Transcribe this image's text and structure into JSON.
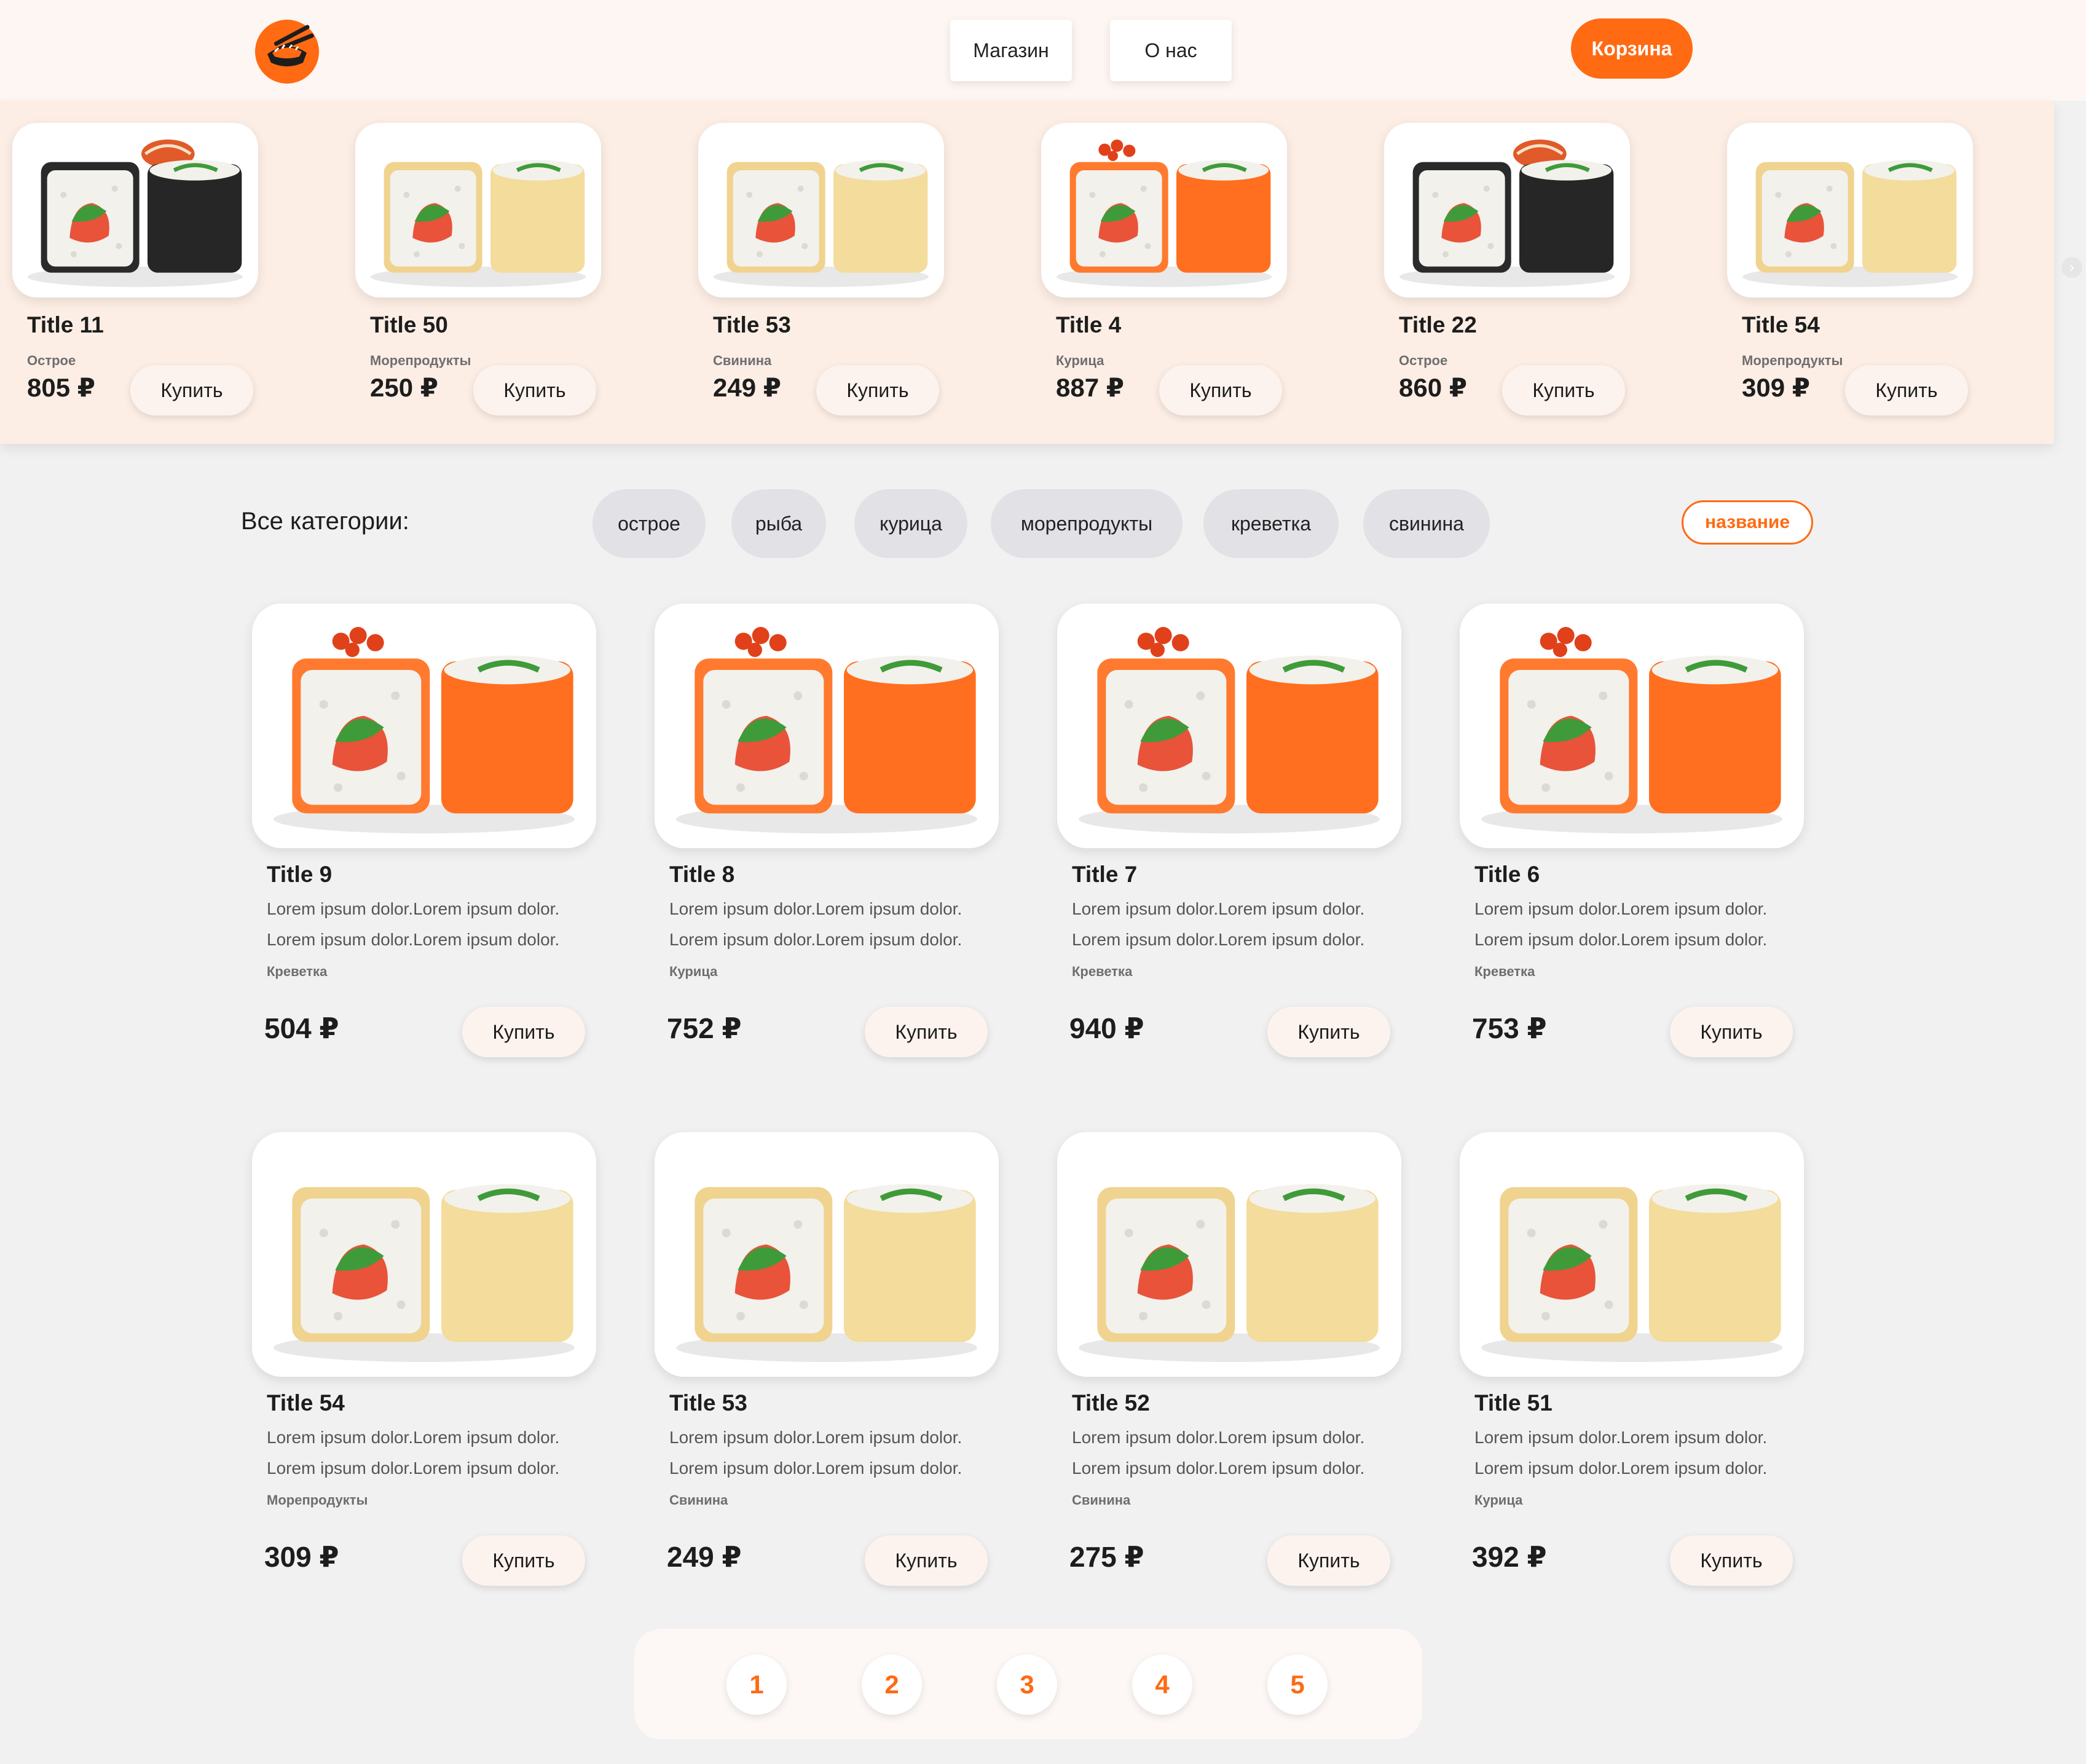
{
  "header": {
    "logo_icon": "sushi-chopsticks-icon",
    "nav": [
      "Магазин",
      "О нас"
    ],
    "cart_label": "Корзина",
    "accent": "#ff6a13"
  },
  "slider": {
    "items": [
      {
        "title": "Title 11",
        "category": "Острое",
        "price": "805 ₽",
        "buy": "Купить",
        "image": "dark-roll"
      },
      {
        "title": "Title 50",
        "category": "Морепродукты",
        "price": "250 ₽",
        "buy": "Купить",
        "image": "cheese-roll"
      },
      {
        "title": "Title 53",
        "category": "Свинина",
        "price": "249 ₽",
        "buy": "Купить",
        "image": "cheese-roll"
      },
      {
        "title": "Title 4",
        "category": "Курица",
        "price": "887 ₽",
        "buy": "Купить",
        "image": "salmon-roll"
      },
      {
        "title": "Title 22",
        "category": "Острое",
        "price": "860 ₽",
        "buy": "Купить",
        "image": "dark-roll"
      },
      {
        "title": "Title 54",
        "category": "Морепродукты",
        "price": "309 ₽",
        "buy": "Купить",
        "image": "cheese-roll"
      }
    ],
    "next_icon": "chevron-right-icon"
  },
  "filters": {
    "label": "Все категории:",
    "categories": [
      "острое",
      "рыба",
      "курица",
      "морепродукты",
      "креветка",
      "свинина"
    ],
    "sort_label": "название"
  },
  "products": [
    {
      "title": "Title 9",
      "desc1": "Lorem ipsum dolor.Lorem ipsum dolor.",
      "desc2": "Lorem ipsum dolor.Lorem ipsum dolor.",
      "category": "Креветка",
      "price": "504 ₽",
      "buy": "Купить",
      "image": "salmon-roll"
    },
    {
      "title": "Title 8",
      "desc1": "Lorem ipsum dolor.Lorem ipsum dolor.",
      "desc2": "Lorem ipsum dolor.Lorem ipsum dolor.",
      "category": "Курица",
      "price": "752 ₽",
      "buy": "Купить",
      "image": "salmon-roll"
    },
    {
      "title": "Title 7",
      "desc1": "Lorem ipsum dolor.Lorem ipsum dolor.",
      "desc2": "Lorem ipsum dolor.Lorem ipsum dolor.",
      "category": "Креветка",
      "price": "940 ₽",
      "buy": "Купить",
      "image": "salmon-roll"
    },
    {
      "title": "Title 6",
      "desc1": "Lorem ipsum dolor.Lorem ipsum dolor.",
      "desc2": "Lorem ipsum dolor.Lorem ipsum dolor.",
      "category": "Креветка",
      "price": "753 ₽",
      "buy": "Купить",
      "image": "salmon-roll"
    },
    {
      "title": "Title 54",
      "desc1": "Lorem ipsum dolor.Lorem ipsum dolor.",
      "desc2": "Lorem ipsum dolor.Lorem ipsum dolor.",
      "category": "Морепродукты",
      "price": "309 ₽",
      "buy": "Купить",
      "image": "cheese-roll"
    },
    {
      "title": "Title 53",
      "desc1": "Lorem ipsum dolor.Lorem ipsum dolor.",
      "desc2": "Lorem ipsum dolor.Lorem ipsum dolor.",
      "category": "Свинина",
      "price": "249 ₽",
      "buy": "Купить",
      "image": "cheese-roll"
    },
    {
      "title": "Title 52",
      "desc1": "Lorem ipsum dolor.Lorem ipsum dolor.",
      "desc2": "Lorem ipsum dolor.Lorem ipsum dolor.",
      "category": "Свинина",
      "price": "275 ₽",
      "buy": "Купить",
      "image": "cheese-roll"
    },
    {
      "title": "Title 51",
      "desc1": "Lorem ipsum dolor.Lorem ipsum dolor.",
      "desc2": "Lorem ipsum dolor.Lorem ipsum dolor.",
      "category": "Курица",
      "price": "392 ₽",
      "buy": "Купить",
      "image": "cheese-roll"
    }
  ],
  "pagination": [
    "1",
    "2",
    "3",
    "4",
    "5"
  ]
}
